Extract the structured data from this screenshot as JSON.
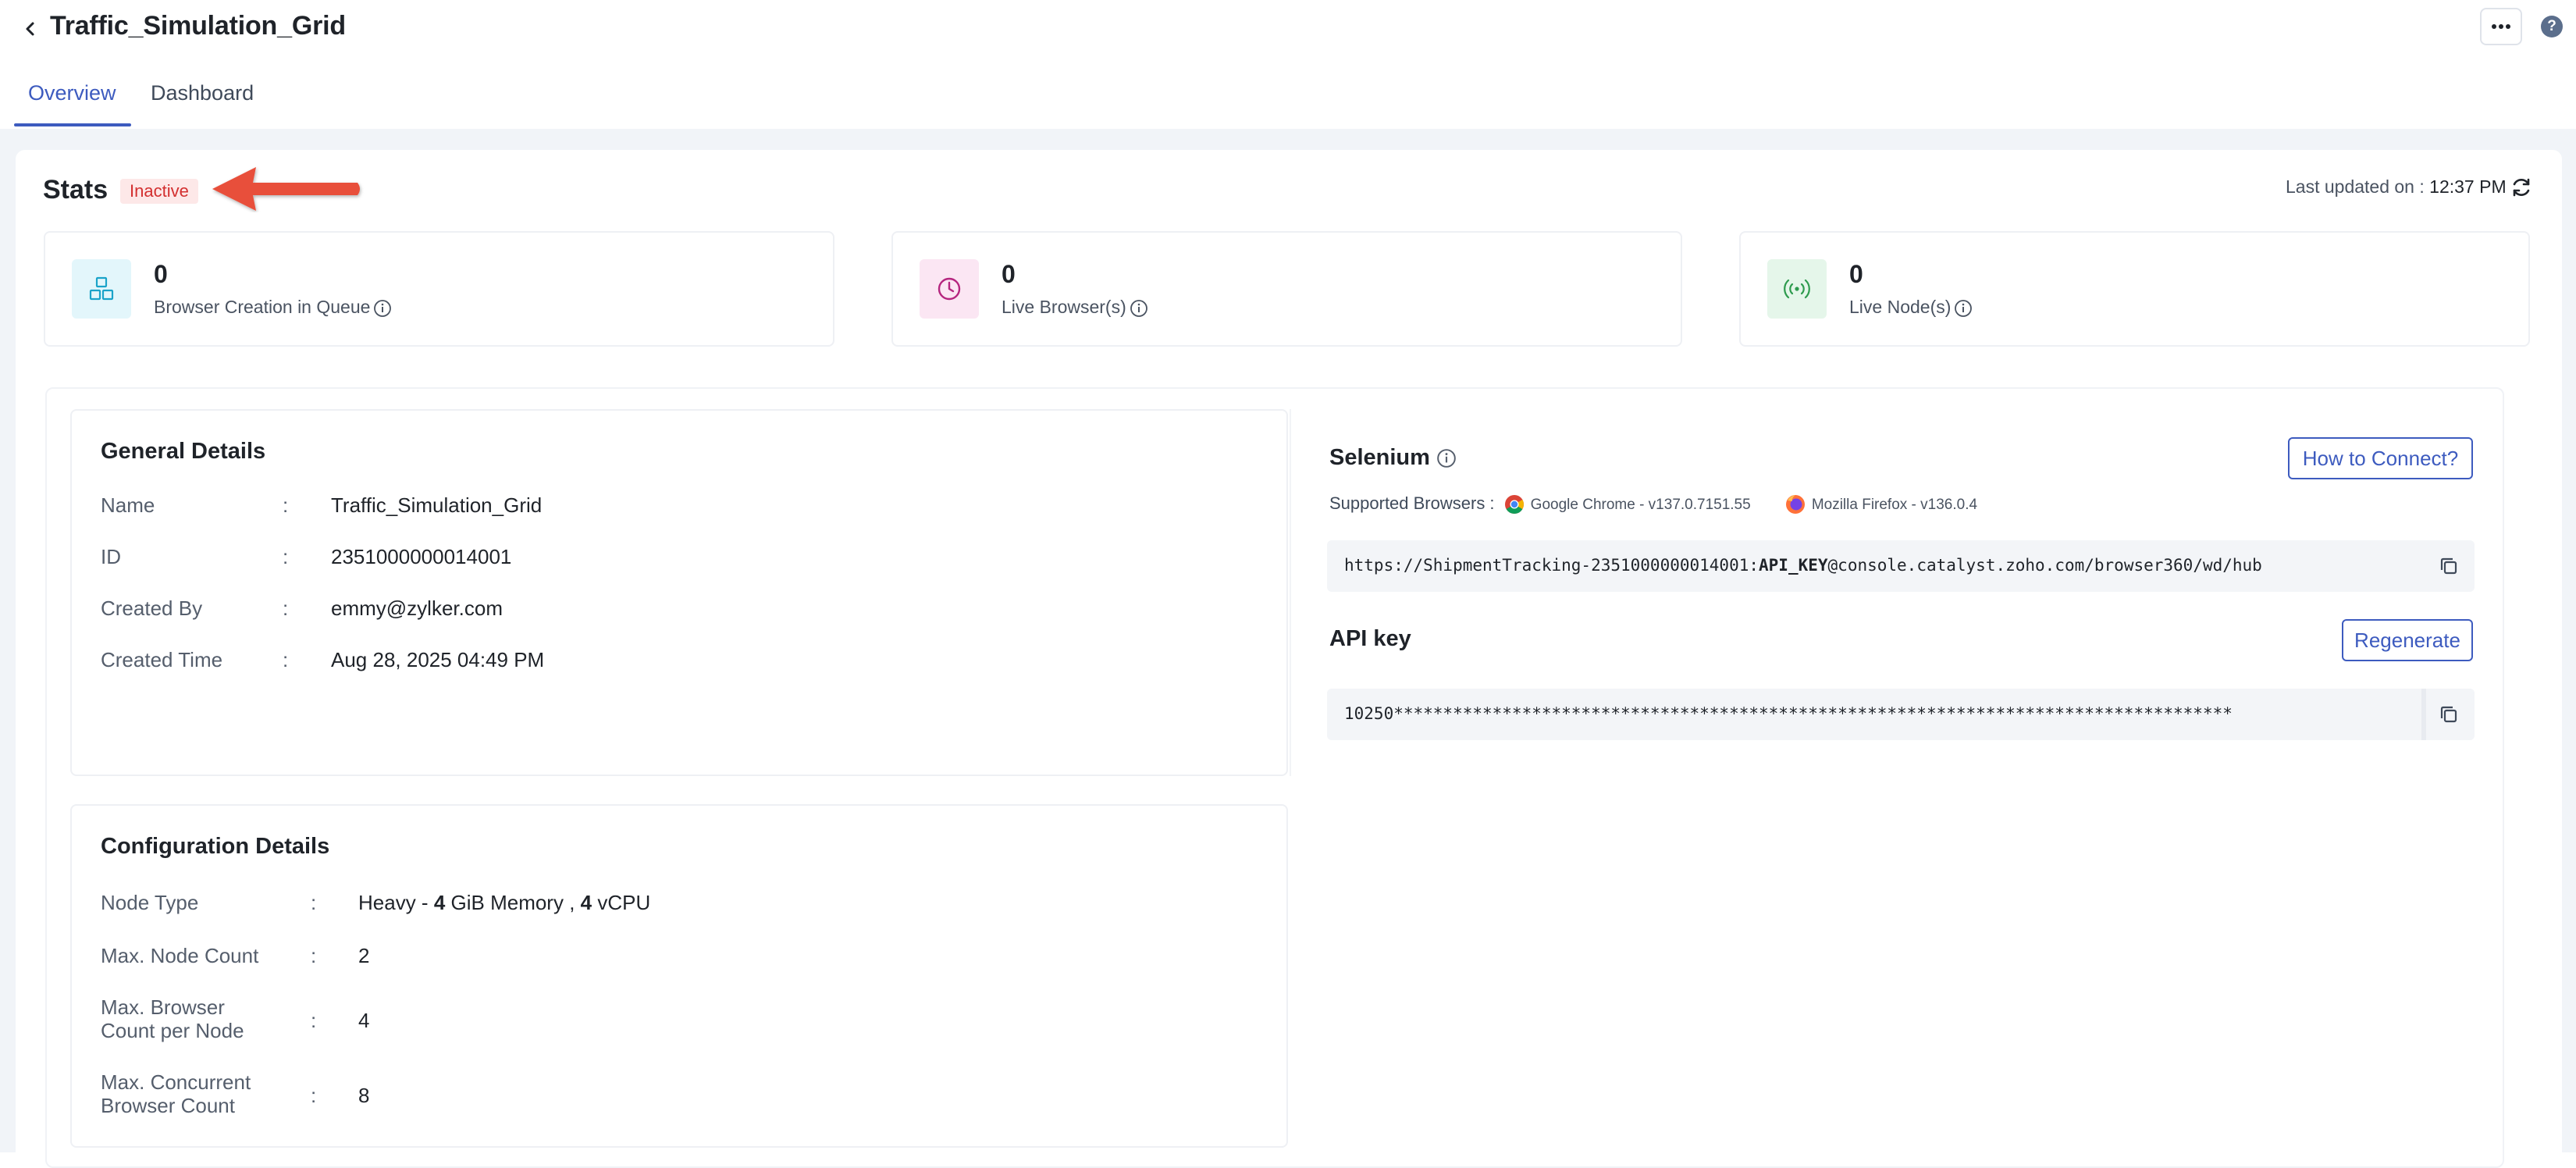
{
  "header": {
    "title": "Traffic_Simulation_Grid",
    "help": "?"
  },
  "tabs": [
    {
      "label": "Overview"
    },
    {
      "label": "Dashboard"
    }
  ],
  "stats": {
    "title": "Stats",
    "status": "Inactive",
    "last_updated_label": "Last updated on : ",
    "last_updated_time": "12:37 PM",
    "cards": [
      {
        "value": "0",
        "label": "Browser Creation in Queue",
        "icon": "cubes-icon",
        "color": "#1aa3c9"
      },
      {
        "value": "0",
        "label": "Live Browser(s)",
        "icon": "clock-icon",
        "color": "#b5267f"
      },
      {
        "value": "0",
        "label": "Live Node(s)",
        "icon": "broadcast-icon",
        "color": "#2e9b4e"
      }
    ]
  },
  "general": {
    "title": "General Details",
    "rows": [
      {
        "key": "Name",
        "value": "Traffic_Simulation_Grid"
      },
      {
        "key": "ID",
        "value": "2351000000014001"
      },
      {
        "key": "Created By",
        "value": "emmy@zylker.com"
      },
      {
        "key": "Created Time",
        "value": "Aug 28, 2025 04:49 PM"
      }
    ]
  },
  "selenium": {
    "title": "Selenium",
    "how_to_connect": "How to Connect?",
    "supported_label": "Supported Browsers :",
    "browsers": [
      {
        "name": "Google Chrome - v137.0.7151.55",
        "icon": "chrome-icon"
      },
      {
        "name": "Mozilla Firefox - v136.0.4",
        "icon": "firefox-icon"
      }
    ],
    "hub_url_prefix": "https://ShipmentTracking-2351000000014001:",
    "hub_url_key": "API_KEY",
    "hub_url_suffix": "@console.catalyst.zoho.com/browser360/wd/hub",
    "api_key_title": "API key",
    "regenerate": "Regenerate",
    "api_key_value": "10250*************************************************************************************"
  },
  "config": {
    "title": "Configuration Details",
    "node_type_key": "Node Type",
    "node_type_prefix": "Heavy - ",
    "memory_value": "4",
    "memory_unit": " GiB Memory",
    "cpu_sep": " , ",
    "cpu_value": "4",
    "cpu_unit": " vCPU",
    "max_node_key": "Max. Node Count",
    "max_node_value": "2",
    "max_browser_key_1": "Max. Browser",
    "max_browser_key_2": "Count per Node",
    "max_browser_value": "4",
    "max_concurrent_key_1": "Max. Concurrent",
    "max_concurrent_key_2": "Browser Count",
    "max_concurrent_value": "8"
  }
}
